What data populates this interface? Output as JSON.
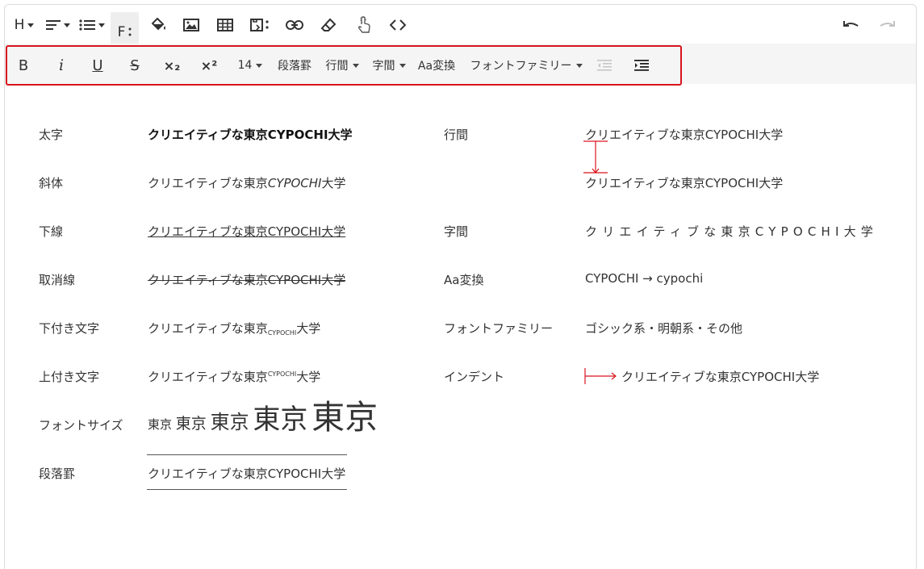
{
  "toolbar_top": {
    "heading": "H",
    "format": "F",
    "items": [
      {
        "name": "heading-button",
        "icon": "heading-icon"
      },
      {
        "name": "align-button",
        "icon": "align-icon"
      },
      {
        "name": "list-button",
        "icon": "list-icon"
      },
      {
        "name": "format-toggle-button",
        "icon": "format-icon"
      },
      {
        "name": "fill-color-button",
        "icon": "paint-bucket-icon"
      },
      {
        "name": "insert-image-button",
        "icon": "image-icon"
      },
      {
        "name": "insert-table-button",
        "icon": "table-icon"
      },
      {
        "name": "insert-gallery-button",
        "icon": "gallery-icon"
      },
      {
        "name": "insert-link-button",
        "icon": "link-icon"
      },
      {
        "name": "clear-format-button",
        "icon": "eraser-icon"
      },
      {
        "name": "tap-button",
        "icon": "hand-pointer-icon"
      },
      {
        "name": "code-view-button",
        "icon": "code-icon"
      },
      {
        "name": "undo-button",
        "icon": "undo-icon"
      },
      {
        "name": "redo-button",
        "icon": "redo-icon"
      }
    ]
  },
  "toolbar_format": {
    "bold": "B",
    "italic": "i",
    "underline": "U",
    "strike": "S",
    "subscript": "×₂",
    "superscript": "×²",
    "font_size": "14",
    "paragraph_rule": "段落罫",
    "line_height": "行間",
    "letter_spacing": "字間",
    "case_convert": "Aa変換",
    "font_family": "フォントファミリー",
    "outdent_icon": "outdent-icon",
    "indent_icon": "indent-icon"
  },
  "highlight_color": "#d9141d",
  "rows": {
    "bold": {
      "label": "太字",
      "sample": "クリエイティブな東京CYPOCHI大学"
    },
    "italic": {
      "label": "斜体",
      "before": "クリエイティブな東京",
      "ital": "CYPOCHI",
      "after": "大学"
    },
    "underline": {
      "label": "下線",
      "sample": "クリエイティブな東京CYPOCHI大学"
    },
    "strike": {
      "label": "取消線",
      "sample": "クリエイティブな東京CYPOCHI大学"
    },
    "subscript": {
      "label": "下付き文字",
      "before": "クリエイティブな東京",
      "small": "CYPOCHI",
      "after": "大学"
    },
    "superscript": {
      "label": "上付き文字",
      "before": "クリエイティブな東京",
      "small": "CYPOCHI",
      "after": "大学"
    },
    "font_size": {
      "label": "フォントサイズ",
      "word": "東京"
    },
    "paragraph_rule": {
      "label": "段落罫",
      "sample": "クリエイティブな東京CYPOCHI大学"
    },
    "line_height": {
      "label": "行間",
      "line1": "クリエイティブな東京CYPOCHI大学",
      "line2": "クリエイティブな東京CYPOCHI大学"
    },
    "letter_spacing": {
      "label": "字間",
      "sample": "クリエイティブな東京CYPOCHI大学"
    },
    "case": {
      "label": "Aa変換",
      "sample": "CYPOCHI → cypochi"
    },
    "font_family": {
      "label": "フォントファミリー",
      "sample": "ゴシック系・明朝系・その他"
    },
    "indent": {
      "label": "インデント",
      "sample": "クリエイティブな東京CYPOCHI大学"
    }
  }
}
